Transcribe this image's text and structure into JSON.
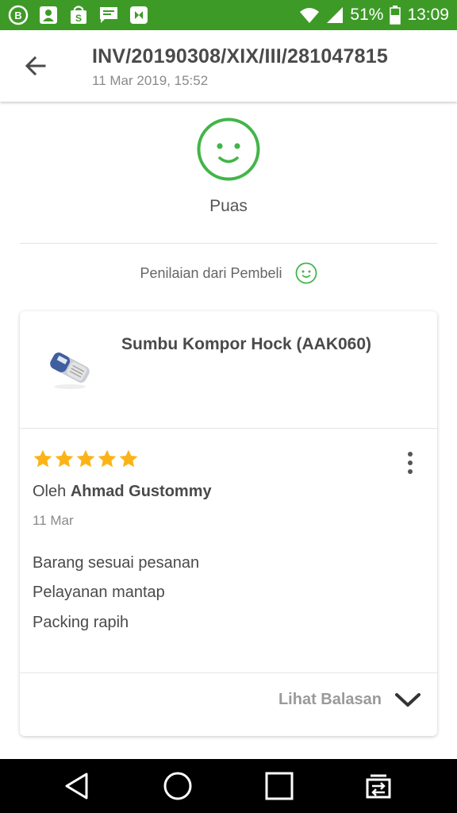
{
  "status_bar": {
    "notification_icons": [
      "bbm-icon",
      "contact-card-icon",
      "shopping-bag-icon",
      "message-icon",
      "tokopedia-icon"
    ],
    "battery": "51%",
    "time": "13:09"
  },
  "header": {
    "back_icon": "arrow-left-icon",
    "invoice": "INV/20190308/XIX/III/281047815",
    "date": "11 Mar 2019, 15:52"
  },
  "summary": {
    "icon": "smile-icon",
    "label": "Puas"
  },
  "rating_source": {
    "label": "Penilaian dari Pembeli",
    "icon": "smile-icon"
  },
  "review": {
    "product_name": "Sumbu Kompor Hock (AAK060)",
    "stars": 5,
    "author_prefix": "Oleh",
    "author": "Ahmad Gustommy",
    "date": "11 Mar",
    "lines": [
      "Barang sesuai pesanan",
      "Pelayanan mantap",
      "Packing rapih"
    ],
    "see_replies": "Lihat Balasan"
  },
  "colors": {
    "brand_green": "#3e9a27",
    "smile_green": "#42b549",
    "star_yellow": "#fbb417"
  },
  "nav_bar": [
    "back-triangle-icon",
    "home-circle-icon",
    "recents-square-icon",
    "switch-apps-icon"
  ]
}
